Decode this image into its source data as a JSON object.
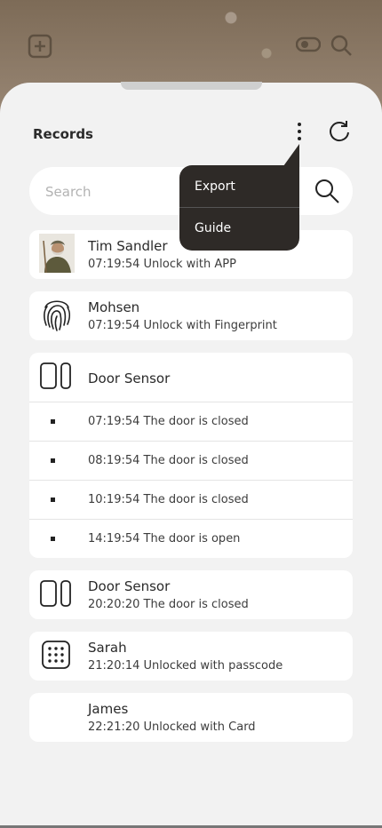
{
  "header": {
    "title": "Records"
  },
  "search": {
    "placeholder": "Search"
  },
  "menu": {
    "items": [
      "Export",
      "Guide"
    ]
  },
  "records": [
    {
      "name": "Tim Sandler",
      "detail": "07:19:54 Unlock with APP",
      "icon": "user-avatar"
    },
    {
      "name": "Mohsen",
      "detail": "07:19:54 Unlock with Fingerprint",
      "icon": "fingerprint-icon"
    },
    {
      "name": "Door Sensor",
      "icon": "door-sensor-icon",
      "events": [
        "07:19:54 The door is closed",
        "08:19:54 The door is closed",
        "10:19:54 The door is closed",
        "14:19:54 The door is open"
      ]
    },
    {
      "name": "Door Sensor",
      "detail": "20:20:20 The door is closed",
      "icon": "door-sensor-icon"
    },
    {
      "name": "Sarah",
      "detail": "21:20:14 Unlocked with passcode",
      "icon": "keypad-icon"
    },
    {
      "name": "James",
      "detail": "22:21:20 Unlocked with Card",
      "icon": ""
    }
  ]
}
